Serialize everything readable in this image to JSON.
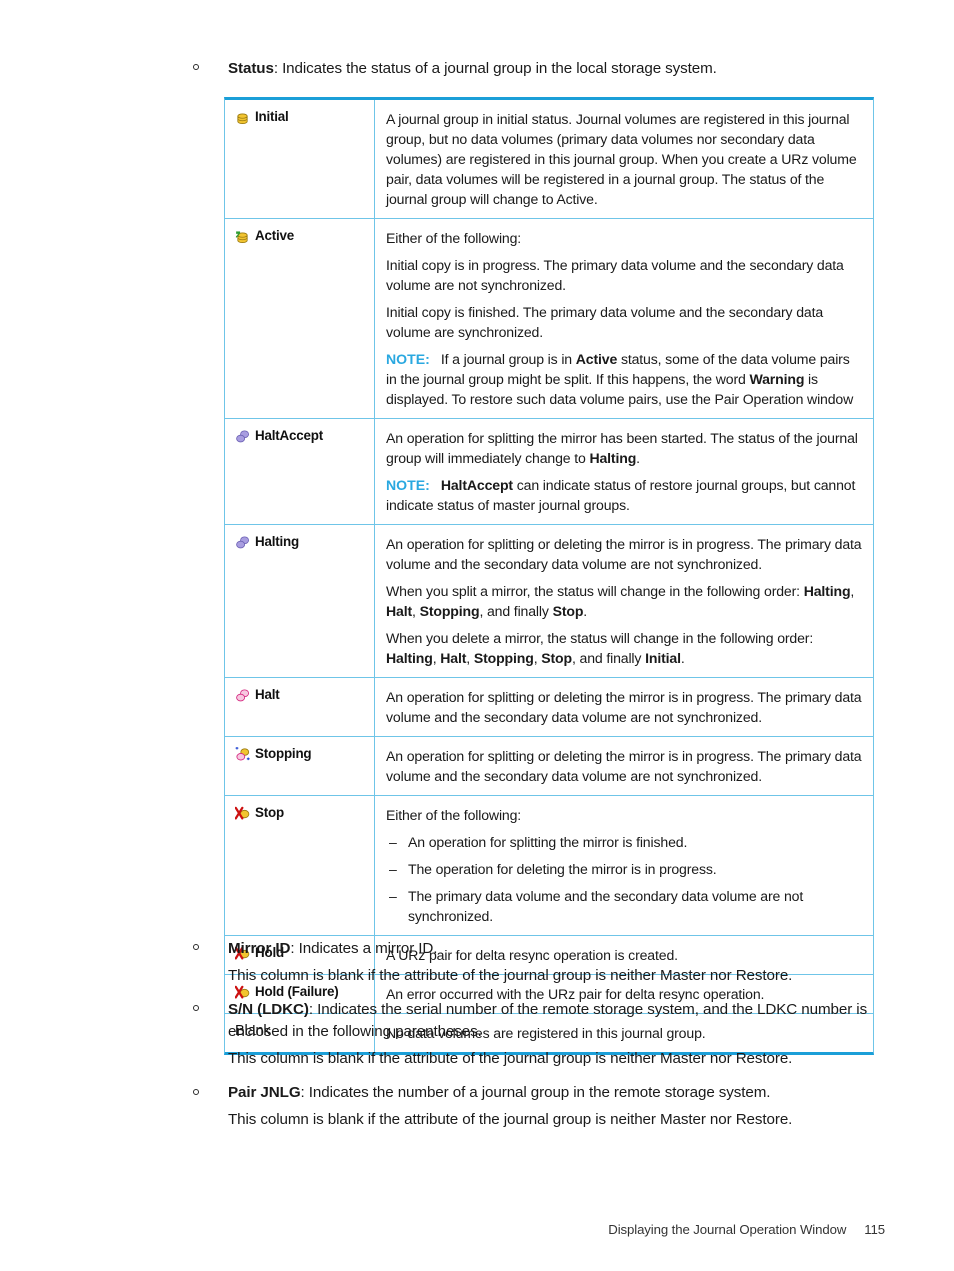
{
  "page": {
    "footer_title": "Displaying the Journal Operation Window",
    "page_number": "115",
    "colors": {
      "table_border_accent": "#1b9fd8",
      "table_border_light": "#6fc5e8",
      "note_label": "#2aa8e0",
      "icon_yellow": "#f2c430",
      "icon_purple": "#a89de0",
      "icon_magenta": "#d4267f",
      "icon_green": "#2e9e34",
      "icon_red": "#cc1111",
      "icon_blue": "#1a3fd0"
    }
  },
  "intro_bullet": {
    "term": "Status",
    "rest": ": Indicates the status of a journal group in the local storage system."
  },
  "status_table": {
    "rows": [
      {
        "icon": "journal-group-initial-icon",
        "label": "Initial",
        "label_bold": true,
        "paragraphs": [
          {
            "type": "text",
            "runs": [
              {
                "t": "A journal group in initial status. Journal volumes are registered in this journal group, but no data volumes (primary data volumes nor secondary data volumes) are registered in this journal group. When you create a URz volume pair, data volumes will be registered in a journal group. The status of the journal group will change to Active.",
                "b": false
              }
            ]
          }
        ]
      },
      {
        "icon": "journal-group-active-icon",
        "label": "Active",
        "label_bold": true,
        "paragraphs": [
          {
            "type": "text",
            "runs": [
              {
                "t": "Either of the following:",
                "b": false
              }
            ]
          },
          {
            "type": "text",
            "runs": [
              {
                "t": "Initial copy is in progress. The primary data volume and the secondary data volume are not synchronized.",
                "b": false
              }
            ]
          },
          {
            "type": "text",
            "runs": [
              {
                "t": "Initial copy is finished. The primary data volume and the secondary data volume are synchronized.",
                "b": false
              }
            ]
          },
          {
            "type": "note",
            "note_label": "NOTE:",
            "runs": [
              {
                "t": "If a journal group is in ",
                "b": false
              },
              {
                "t": "Active",
                "b": true
              },
              {
                "t": " status, some of the data volume pairs in the journal group might be split. If this happens, the word ",
                "b": false
              },
              {
                "t": "Warning",
                "b": true
              },
              {
                "t": " is displayed. To restore such data volume pairs, use the Pair Operation window",
                "b": false
              }
            ]
          }
        ]
      },
      {
        "icon": "journal-group-haltaccept-icon",
        "label": "HaltAccept",
        "label_bold": true,
        "paragraphs": [
          {
            "type": "text",
            "runs": [
              {
                "t": "An operation for splitting the mirror has been started. The status of the journal group will immediately change to ",
                "b": false
              },
              {
                "t": "Halting",
                "b": true
              },
              {
                "t": ".",
                "b": false
              }
            ]
          },
          {
            "type": "note",
            "note_label": "NOTE:",
            "runs": [
              {
                "t": "HaltAccept",
                "b": true
              },
              {
                "t": " can indicate status of restore journal groups, but cannot indicate status of master journal groups.",
                "b": false
              }
            ]
          }
        ]
      },
      {
        "icon": "journal-group-halting-icon",
        "label": "Halting",
        "label_bold": true,
        "paragraphs": [
          {
            "type": "text",
            "runs": [
              {
                "t": "An operation for splitting or deleting the mirror is in progress. The primary data volume and the secondary data volume are not synchronized.",
                "b": false
              }
            ]
          },
          {
            "type": "text",
            "runs": [
              {
                "t": "When you split a mirror, the status will change in the following order: ",
                "b": false
              },
              {
                "t": "Halting",
                "b": true
              },
              {
                "t": ", ",
                "b": false
              },
              {
                "t": "Halt",
                "b": true
              },
              {
                "t": ", ",
                "b": false
              },
              {
                "t": "Stopping",
                "b": true
              },
              {
                "t": ", and finally ",
                "b": false
              },
              {
                "t": "Stop",
                "b": true
              },
              {
                "t": ".",
                "b": false
              }
            ]
          },
          {
            "type": "text",
            "runs": [
              {
                "t": "When you delete a mirror, the status will change in the following order: ",
                "b": false
              },
              {
                "t": "Halting",
                "b": true
              },
              {
                "t": ", ",
                "b": false
              },
              {
                "t": "Halt",
                "b": true
              },
              {
                "t": ", ",
                "b": false
              },
              {
                "t": "Stopping",
                "b": true
              },
              {
                "t": ", ",
                "b": false
              },
              {
                "t": "Stop",
                "b": true
              },
              {
                "t": ", and finally ",
                "b": false
              },
              {
                "t": "Initial",
                "b": true
              },
              {
                "t": ".",
                "b": false
              }
            ]
          }
        ]
      },
      {
        "icon": "journal-group-halt-icon",
        "label": "Halt",
        "label_bold": true,
        "paragraphs": [
          {
            "type": "text",
            "runs": [
              {
                "t": "An operation for splitting or deleting the mirror is in progress. The primary data volume and the secondary data volume are not synchronized.",
                "b": false
              }
            ]
          }
        ]
      },
      {
        "icon": "journal-group-stopping-icon",
        "label": "Stopping",
        "label_bold": true,
        "paragraphs": [
          {
            "type": "text",
            "runs": [
              {
                "t": "An operation for splitting or deleting the mirror is in progress. The primary data volume and the secondary data volume are not synchronized.",
                "b": false
              }
            ]
          }
        ]
      },
      {
        "icon": "journal-group-stop-icon",
        "label": "Stop",
        "label_bold": true,
        "paragraphs": [
          {
            "type": "text",
            "runs": [
              {
                "t": "Either of the following:",
                "b": false
              }
            ]
          },
          {
            "type": "dashlist",
            "items": [
              "An operation for splitting the mirror is finished.",
              "The operation for deleting the mirror is in progress.",
              "The primary data volume and the secondary data volume are not synchronized."
            ]
          }
        ]
      },
      {
        "icon": "journal-group-hold-icon",
        "label": "Hold",
        "label_bold": true,
        "paragraphs": [
          {
            "type": "text",
            "runs": [
              {
                "t": "A URz pair for delta resync operation is created.",
                "b": false
              }
            ]
          }
        ]
      },
      {
        "icon": "journal-group-hold-failure-icon",
        "label": "Hold (Failure)",
        "label_bold": true,
        "paragraphs": [
          {
            "type": "text",
            "runs": [
              {
                "t": "An error occurred with the URz pair for delta resync operation.",
                "b": false
              }
            ]
          }
        ]
      },
      {
        "icon": "none",
        "label": "Blank",
        "label_bold": false,
        "paragraphs": [
          {
            "type": "text",
            "runs": [
              {
                "t": "No data volumes are registered in this journal group.",
                "b": false
              }
            ]
          }
        ]
      }
    ]
  },
  "bottom_bullets": [
    {
      "term": "Mirror ID",
      "rest": ": Indicates a mirror ID.",
      "sub": "This column is blank if the attribute of the journal group is neither Master nor Restore."
    },
    {
      "term": "S/N (LDKC)",
      "rest": ": Indicates the serial number of the remote storage system, and the LDKC number is enclosed in the following parentheses.",
      "sub": "This column is blank if the attribute of the journal group is neither Master nor Restore."
    },
    {
      "term": "Pair JNLG",
      "rest": ": Indicates the number of a journal group in the remote storage system.",
      "sub": "This column is blank if the attribute of the journal group is neither Master nor Restore."
    }
  ]
}
